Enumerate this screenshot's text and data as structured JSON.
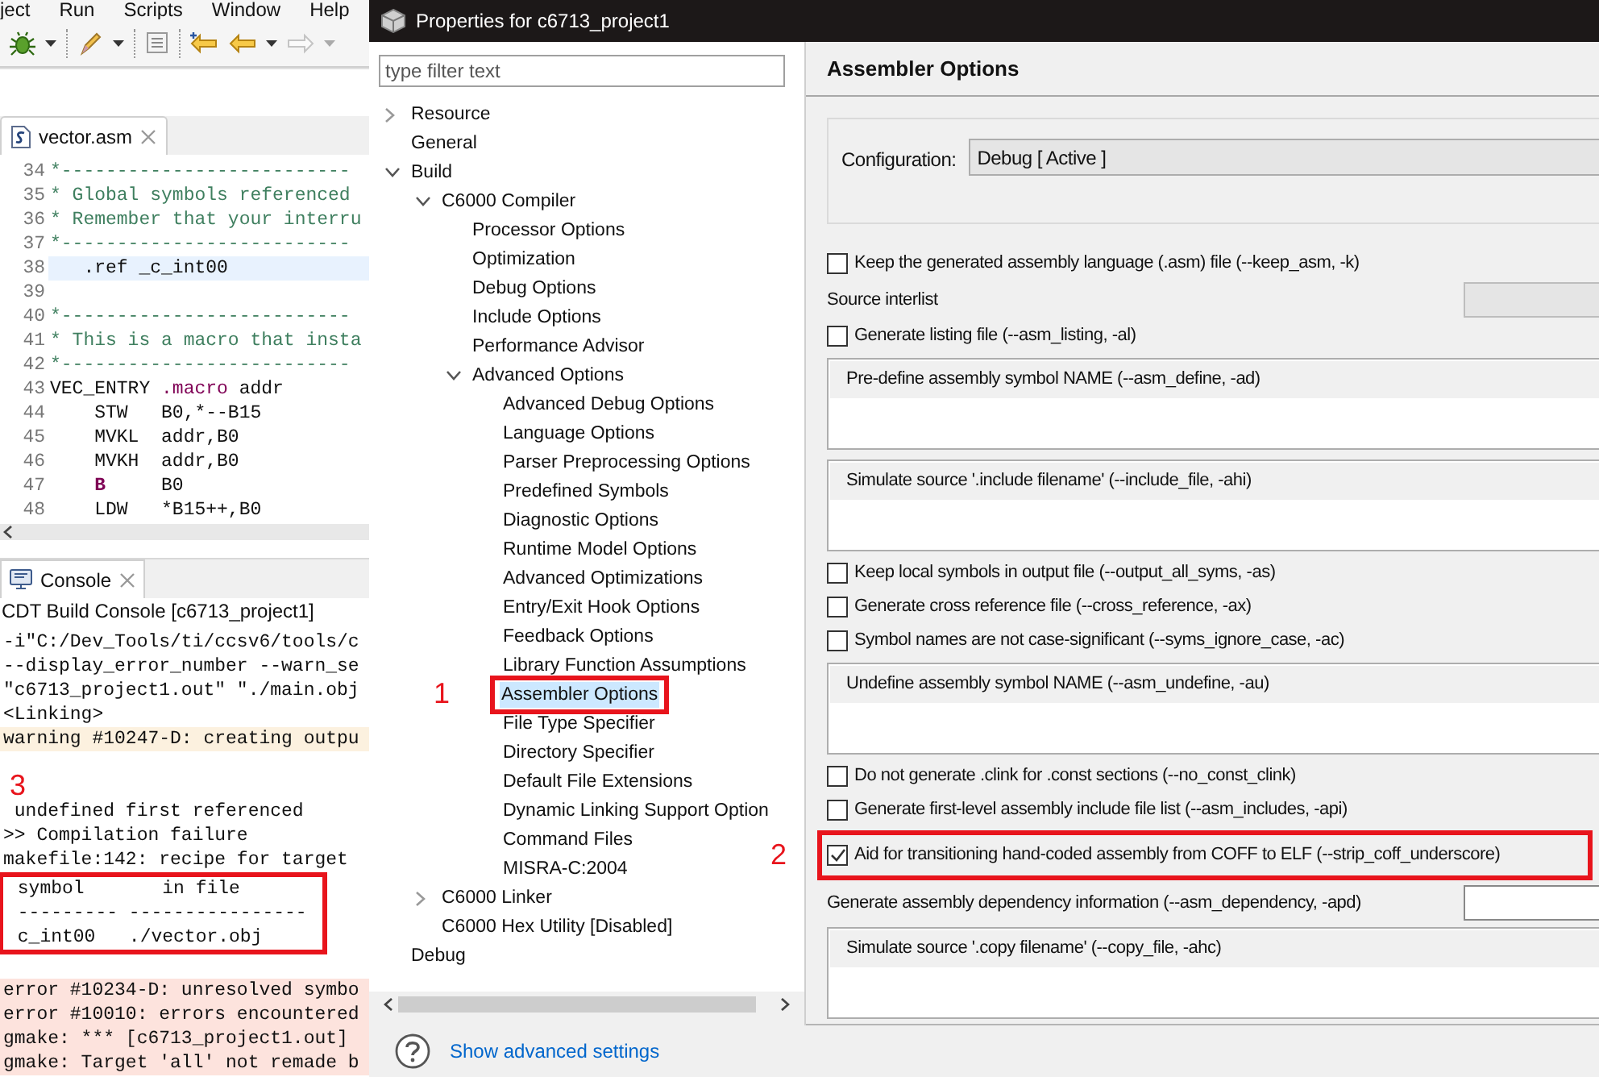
{
  "ide": {
    "menu": [
      "ject",
      "Run",
      "Scripts",
      "Window",
      "Help"
    ],
    "editor": {
      "tab": "vector.asm",
      "lines": [
        {
          "number": "34",
          "current": false,
          "segments": [
            {
              "text": "*--------------------------",
              "kind": "comment"
            }
          ]
        },
        {
          "number": "35",
          "current": false,
          "segments": [
            {
              "text": "* Global symbols referenced",
              "kind": "comment"
            }
          ]
        },
        {
          "number": "36",
          "current": false,
          "segments": [
            {
              "text": "* Remember that your interru",
              "kind": "comment"
            }
          ]
        },
        {
          "number": "37",
          "current": false,
          "segments": [
            {
              "text": "*--------------------------",
              "kind": "comment"
            }
          ]
        },
        {
          "number": "38",
          "current": true,
          "segments": [
            {
              "text": "   .ref _c_int00",
              "kind": "plain"
            }
          ]
        },
        {
          "number": "39",
          "current": false
        },
        {
          "number": "40",
          "current": false,
          "segments": [
            {
              "text": "*--------------------------",
              "kind": "comment"
            }
          ]
        },
        {
          "number": "41",
          "current": false,
          "segments": [
            {
              "text": "* This is a macro that insta",
              "kind": "comment"
            }
          ]
        },
        {
          "number": "42",
          "current": false,
          "segments": [
            {
              "text": "*--------------------------",
              "kind": "comment"
            }
          ]
        },
        {
          "number": "43",
          "current": false,
          "segments": [
            {
              "text": "VEC_ENTRY ",
              "kind": "plain"
            },
            {
              "text": ".macro",
              "kind": "directive"
            },
            {
              "text": " addr",
              "kind": "plain"
            }
          ]
        },
        {
          "number": "44",
          "current": false,
          "segments": [
            {
              "text": "    STW   B0,*--B15",
              "kind": "plain"
            }
          ]
        },
        {
          "number": "45",
          "current": false,
          "segments": [
            {
              "text": "    MVKL  addr,B0",
              "kind": "plain"
            }
          ]
        },
        {
          "number": "46",
          "current": false,
          "segments": [
            {
              "text": "    MVKH  addr,B0",
              "kind": "plain"
            }
          ]
        },
        {
          "number": "47",
          "current": false,
          "segments": [
            {
              "text": "    B",
              "kind": "instruction"
            },
            {
              "text": "     B0",
              "kind": "plain"
            }
          ]
        },
        {
          "number": "48",
          "current": false,
          "segments": [
            {
              "text": "    LDW   *B15++,B0",
              "kind": "plain"
            }
          ]
        }
      ]
    },
    "console": {
      "tab": "Console",
      "title": "CDT Build Console [c6713_project1]",
      "lines": [
        {
          "kind": "plain",
          "highlighted": false,
          "text": "-i\"C:/Dev_Tools/ti/ccsv6/tools/c"
        },
        {
          "kind": "plain",
          "highlighted": false,
          "text": "--display_error_number --warn_se"
        },
        {
          "kind": "plain",
          "highlighted": false,
          "text": "\"c6713_project1.out\" \"./main.obj"
        },
        {
          "kind": "plain",
          "highlighted": false,
          "text": "<Linking>"
        },
        {
          "kind": "warning",
          "highlighted": false,
          "text": "warning #10247-D: creating outpu"
        },
        {
          "kind": "blank",
          "highlighted": false
        },
        {
          "kind": "blank",
          "highlighted": false,
          "marker": "3"
        },
        {
          "kind": "plain",
          "highlighted": false,
          "text": " undefined first referenced"
        },
        {
          "kind": "plain",
          "highlighted": false,
          "text": ">> Compilation failure"
        },
        {
          "kind": "plain",
          "highlighted": false,
          "text": "makefile:142: recipe for target"
        },
        {
          "kind": "plain",
          "highlighted": true,
          "text": " symbol       in file"
        },
        {
          "kind": "plain",
          "highlighted": true,
          "text": " --------- ----------------"
        },
        {
          "kind": "plain",
          "highlighted": true,
          "text": " c_int00   ./vector.obj"
        },
        {
          "kind": "blank",
          "highlighted": false
        },
        {
          "kind": "error",
          "highlighted": false,
          "text": "error #10234-D: unresolved symbo"
        },
        {
          "kind": "error",
          "highlighted": false,
          "text": "error #10010: errors encountered"
        },
        {
          "kind": "error",
          "highlighted": false,
          "text": "gmake: *** [c6713_project1.out]"
        },
        {
          "kind": "error",
          "highlighted": false,
          "text": "gmake: Target 'all' not remade b"
        }
      ]
    }
  },
  "dialog": {
    "title": "Properties for c6713_project1",
    "filter": {
      "placeholder": "type filter text"
    },
    "tree": [
      {
        "label": "Resource",
        "selected": false,
        "highlighted": false,
        "expanded": false
      },
      {
        "label": "General",
        "selected": false,
        "highlighted": false
      },
      {
        "label": "Build",
        "selected": false,
        "highlighted": false,
        "expanded": true,
        "children": [
          {
            "label": "C6000 Compiler",
            "selected": false,
            "highlighted": false,
            "expanded": true,
            "children": [
              {
                "label": "Processor Options",
                "selected": false,
                "highlighted": false
              },
              {
                "label": "Optimization",
                "selected": false,
                "highlighted": false
              },
              {
                "label": "Debug Options",
                "selected": false,
                "highlighted": false
              },
              {
                "label": "Include Options",
                "selected": false,
                "highlighted": false
              },
              {
                "label": "Performance Advisor",
                "selected": false,
                "highlighted": false
              },
              {
                "label": "Advanced Options",
                "selected": false,
                "highlighted": false,
                "expanded": true,
                "children": [
                  {
                    "label": "Advanced Debug Options",
                    "selected": false,
                    "highlighted": false
                  },
                  {
                    "label": "Language Options",
                    "selected": false,
                    "highlighted": false
                  },
                  {
                    "label": "Parser Preprocessing Options",
                    "selected": false,
                    "highlighted": false
                  },
                  {
                    "label": "Predefined Symbols",
                    "selected": false,
                    "highlighted": false
                  },
                  {
                    "label": "Diagnostic Options",
                    "selected": false,
                    "highlighted": false
                  },
                  {
                    "label": "Runtime Model Options",
                    "selected": false,
                    "highlighted": false
                  },
                  {
                    "label": "Advanced Optimizations",
                    "selected": false,
                    "highlighted": false
                  },
                  {
                    "label": "Entry/Exit Hook Options",
                    "selected": false,
                    "highlighted": false
                  },
                  {
                    "label": "Feedback Options",
                    "selected": false,
                    "highlighted": false
                  },
                  {
                    "label": "Library Function Assumptions",
                    "selected": false,
                    "highlighted": false
                  },
                  {
                    "label": "Assembler Options",
                    "selected": true,
                    "highlighted": true,
                    "marker": "1"
                  },
                  {
                    "label": "File Type Specifier",
                    "selected": false,
                    "highlighted": false
                  },
                  {
                    "label": "Directory Specifier",
                    "selected": false,
                    "highlighted": false
                  },
                  {
                    "label": "Default File Extensions",
                    "selected": false,
                    "highlighted": false
                  },
                  {
                    "label": "Dynamic Linking Support Option",
                    "selected": false,
                    "highlighted": false
                  },
                  {
                    "label": "Command Files",
                    "selected": false,
                    "highlighted": false
                  },
                  {
                    "label": "MISRA-C:2004",
                    "selected": false,
                    "highlighted": false
                  }
                ]
              }
            ]
          },
          {
            "label": "C6000 Linker",
            "selected": false,
            "highlighted": false,
            "expanded": false
          },
          {
            "label": "C6000 Hex Utility  [Disabled]",
            "selected": false,
            "highlighted": false
          }
        ]
      },
      {
        "label": "Debug",
        "selected": false,
        "highlighted": false
      }
    ],
    "page": {
      "title": "Assembler Options",
      "configuration": {
        "label": "Configuration:",
        "value": "Debug  [ Active ]"
      },
      "options": [
        {
          "kind": "checkbox",
          "label": "Keep the generated assembly language (.asm) file (--keep_asm, -k)",
          "checked": false,
          "highlighted": false
        },
        {
          "kind": "select",
          "label": "Source interlist",
          "disabled": true,
          "highlighted": false
        },
        {
          "kind": "checkbox",
          "label": "Generate listing file (--asm_listing, -al)",
          "checked": false,
          "highlighted": false
        },
        {
          "kind": "list",
          "label": "Pre-define assembly symbol NAME (--asm_define, -ad)",
          "highlighted": false
        },
        {
          "kind": "list",
          "label": "Simulate source '.include filename' (--include_file, -ahi)",
          "highlighted": false
        },
        {
          "kind": "checkbox",
          "label": "Keep local symbols in output file (--output_all_syms, -as)",
          "checked": false,
          "highlighted": false
        },
        {
          "kind": "checkbox",
          "label": "Generate cross reference file (--cross_reference, -ax)",
          "checked": false,
          "highlighted": false
        },
        {
          "kind": "checkbox",
          "label": "Symbol names are not case-significant (--syms_ignore_case, -ac)",
          "checked": false,
          "highlighted": false
        },
        {
          "kind": "list",
          "label": "Undefine assembly symbol NAME (--asm_undefine, -au)",
          "highlighted": false
        },
        {
          "kind": "checkbox",
          "label": "Do not generate .clink for .const sections (--no_const_clink)",
          "checked": false,
          "highlighted": false
        },
        {
          "kind": "checkbox",
          "label": "Generate first-level assembly include file list (--asm_includes, -api)",
          "checked": false,
          "highlighted": false
        },
        {
          "kind": "checkbox",
          "label": "Aid for transitioning hand-coded assembly from COFF to ELF (--strip_coff_underscore)",
          "checked": true,
          "highlighted": true,
          "marker": "2"
        },
        {
          "kind": "select",
          "label": "Generate assembly dependency information (--asm_dependency, -apd)",
          "disabled": false,
          "highlighted": false
        },
        {
          "kind": "list",
          "label": "Simulate source '.copy filename' (--copy_file, -ahc)",
          "highlighted": false
        }
      ]
    },
    "footer": {
      "link": "Show advanced settings"
    }
  }
}
